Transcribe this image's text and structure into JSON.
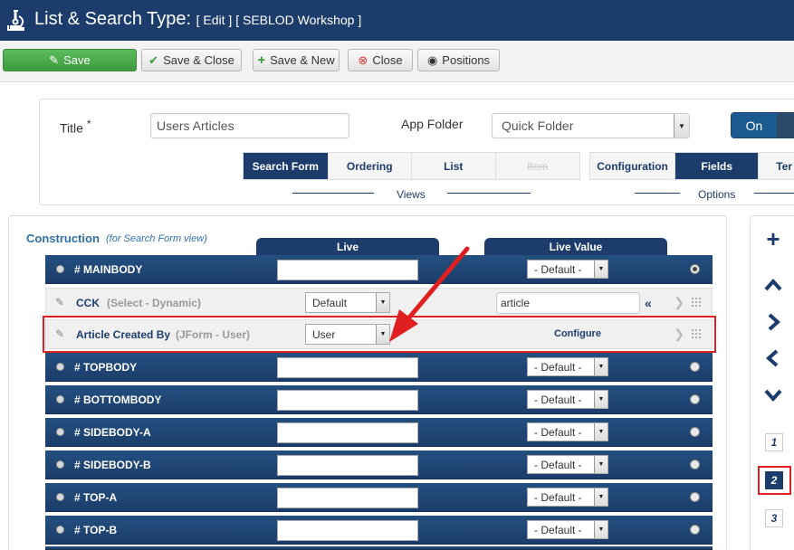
{
  "header": {
    "title": "List & Search Type:",
    "subtitle": "[ Edit ] [ SEBLOD Workshop ]",
    "logo_icon": "microscope-icon"
  },
  "toolbar": {
    "save_label": "Save",
    "save_close_label": "Save & Close",
    "save_new_label": "Save & New",
    "close_label": "Close",
    "positions_label": "Positions"
  },
  "form": {
    "title_label": "Title",
    "title_required": "*",
    "title_value": "Users Articles",
    "app_folder_label": "App Folder",
    "app_folder_value": "Quick Folder",
    "toggle_on_label": "On"
  },
  "views": {
    "group_label": "Views",
    "tabs": [
      {
        "label": "Search Form",
        "active": true
      },
      {
        "label": "Ordering",
        "active": false
      },
      {
        "label": "List",
        "active": false
      },
      {
        "label": "Item",
        "active": false,
        "disabled": true
      }
    ]
  },
  "options": {
    "group_label": "Options",
    "tabs": [
      {
        "label": "Configuration",
        "active": false
      },
      {
        "label": "Fields",
        "active": true
      },
      {
        "label": "Ter",
        "active": false
      }
    ]
  },
  "construction": {
    "title": "Construction",
    "subtitle": "(for Search Form view)",
    "col_live": "Live",
    "col_live_value": "Live Value",
    "rows": [
      {
        "type": "position",
        "name": "# MAINBODY",
        "default": "- Default -",
        "checked": true
      },
      {
        "type": "field",
        "name": "CCK",
        "field_type": "(Select - Dynamic)",
        "live": "Default",
        "live_value": "article",
        "back": "«"
      },
      {
        "type": "field",
        "name": "Article Created By",
        "field_type": "(JForm - User)",
        "live": "User",
        "configure": "Configure"
      },
      {
        "type": "position",
        "name": "# TOPBODY",
        "default": "- Default -"
      },
      {
        "type": "position",
        "name": "# BOTTOMBODY",
        "default": "- Default -"
      },
      {
        "type": "position",
        "name": "# SIDEBODY-A",
        "default": "- Default -"
      },
      {
        "type": "position",
        "name": "# SIDEBODY-B",
        "default": "- Default -"
      },
      {
        "type": "position",
        "name": "# TOP-A",
        "default": "- Default -"
      },
      {
        "type": "position",
        "name": "# TOP-B",
        "default": "- Default -"
      }
    ]
  },
  "sidebar": {
    "icons": [
      "plus-icon",
      "chevron-up-icon",
      "chevron-right-icon",
      "chevron-left-icon",
      "chevron-down-icon"
    ],
    "pages": [
      {
        "label": "1",
        "active": false
      },
      {
        "label": "2",
        "active": true
      },
      {
        "label": "3",
        "active": false
      }
    ]
  },
  "colors": {
    "header_bg": "#1c3d6b",
    "save_green": "#4cae4c",
    "accent_blue": "#2f6fa6",
    "highlight_red": "#e02020"
  }
}
